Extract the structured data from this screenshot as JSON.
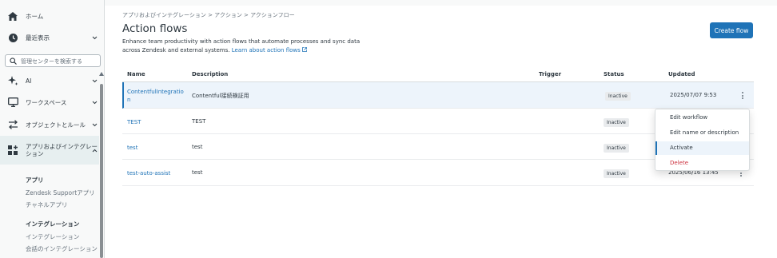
{
  "sidebar": {
    "items": [
      {
        "label": "ホーム",
        "icon": "home-icon"
      },
      {
        "label": "最近表示",
        "icon": "clock-icon"
      },
      {
        "label": "AI",
        "icon": "sparkle-icon"
      },
      {
        "label": "ワークスペース",
        "icon": "monitor-icon"
      },
      {
        "label": "オブジェクトとルール",
        "icon": "arrows-icon"
      },
      {
        "label": "アプリおよびインテグレー\nション",
        "icon": "apps-icon"
      }
    ],
    "search_placeholder": "管理センターを検索する",
    "apps_section": {
      "heading": "アプリ",
      "items": [
        "Zendesk Supportアプリ",
        "チャネルアプリ"
      ]
    },
    "integrations_section": {
      "heading": "インテグレーション",
      "items": [
        "インテグレーション",
        "会話のインテグレーション"
      ]
    }
  },
  "main": {
    "breadcrumb": "アプリおよびインテグレーション > アクション > アクションフロー",
    "title": "Action flows",
    "description": "Enhance team productivity with action flows that automate processes and sync data across Zendesk and external systems.",
    "learn_more": "Learn about action flows",
    "create_button": "Create flow",
    "columns": [
      "Name",
      "Description",
      "Trigger",
      "Status",
      "Updated"
    ],
    "rows": [
      {
        "name": "ContentfulIntegratio\nn",
        "description": "Contentful接続検証用",
        "trigger": "",
        "status": "Inactive",
        "updated": "2025/07/07 9:53"
      },
      {
        "name": "TEST",
        "description": "TEST",
        "trigger": "",
        "status": "Inactive",
        "updated": ""
      },
      {
        "name": "test",
        "description": "test",
        "trigger": "",
        "status": "Inactive",
        "updated": ""
      },
      {
        "name": "test-auto-assist",
        "description": "test",
        "trigger": "",
        "status": "Inactive",
        "updated": "2025/06/16 13:45"
      }
    ]
  },
  "menu": {
    "items": [
      "Edit workflow",
      "Edit name or description",
      "Activate",
      "Delete"
    ]
  },
  "colors": {
    "accent": "#1f73b7",
    "danger": "#cc3340",
    "sidebar_bg": "#f8f9f9",
    "selected_row": "#edf4fb"
  }
}
